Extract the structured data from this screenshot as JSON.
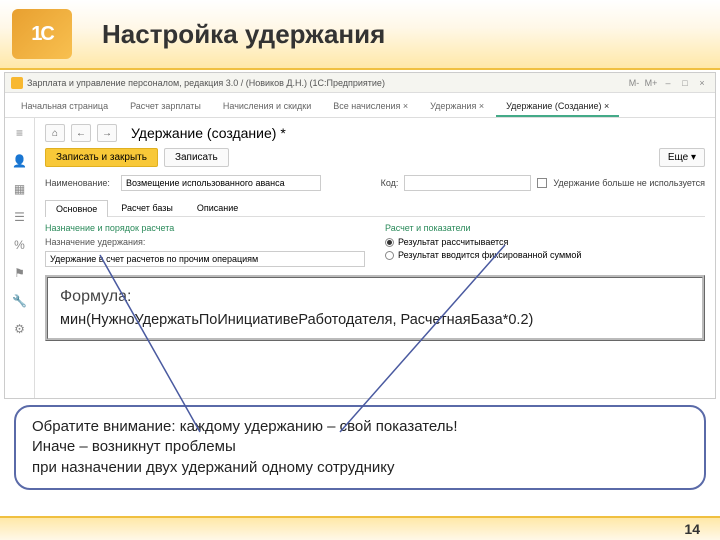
{
  "header": {
    "title": "Настройка удержания"
  },
  "titlebar": {
    "title": "Зарплата и управление персоналом, редакция 3.0 / (Новиков Д.Н.) (1С:Предприятие)"
  },
  "mainTabs": [
    "Начальная страница",
    "Расчет зарплаты",
    "Начисления и скидки",
    "Все начисления ×",
    "Удержания ×",
    "Удержание (Создание) ×"
  ],
  "subTitle": "Удержание (создание) *",
  "buttons": {
    "saveClose": "Записать и закрыть",
    "save": "Записать",
    "more": "Еще ▾"
  },
  "nameField": {
    "label": "Наименование:",
    "value": "Возмещение использованного аванса"
  },
  "codeField": {
    "label": "Код:"
  },
  "unusedCheckbox": "Удержание больше не используется",
  "subTabs": [
    "Основное",
    "Расчет базы",
    "Описание"
  ],
  "leftCol": {
    "head": "Назначение и порядок расчета",
    "label": "Назначение удержания:",
    "value": "Удержание в счет расчетов по прочим операциям"
  },
  "rightCol": {
    "head": "Расчет и показатели",
    "opt1": "Результат рассчитывается",
    "opt2": "Результат вводится фиксированной суммой"
  },
  "formula": {
    "label": "Формула:",
    "text": "мин(НужноУдержатьПоИнициативеРаботодателя, РасчетнаяБаза*0.2)"
  },
  "note": {
    "l1": "Обратите внимание: каждому удержанию – свой показатель!",
    "l2": "Иначе – возникнут проблемы",
    "l3": "при назначении двух удержаний одному сотруднику"
  },
  "pageNum": "14"
}
